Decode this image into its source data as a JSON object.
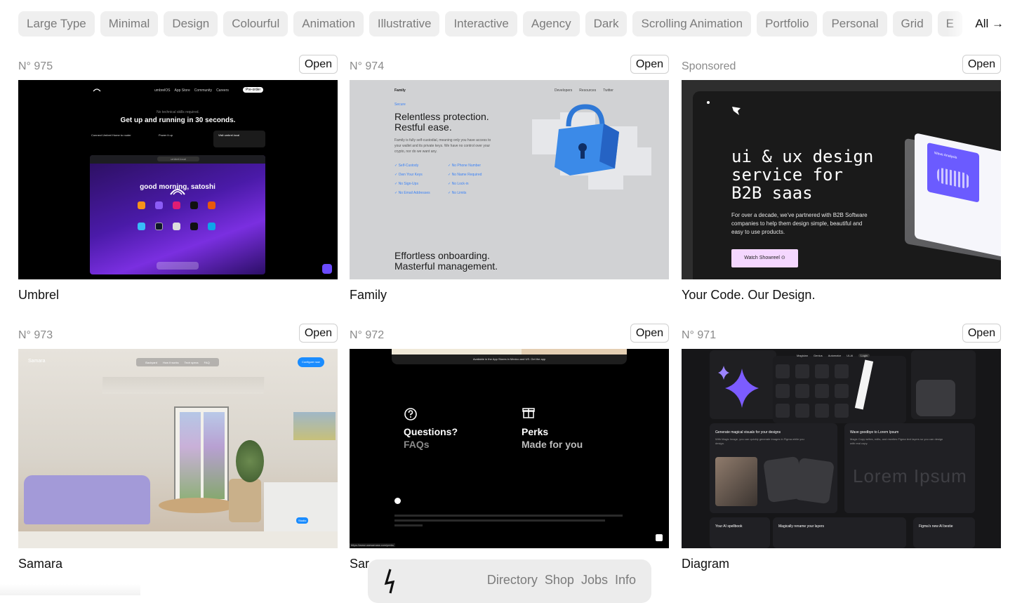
{
  "filters": {
    "chips": [
      "Large Type",
      "Minimal",
      "Design",
      "Colourful",
      "Animation",
      "Illustrative",
      "Interactive",
      "Agency",
      "Dark",
      "Scrolling Animation",
      "Portfolio",
      "Personal",
      "Grid",
      "E"
    ],
    "all_label": "All →"
  },
  "cards": [
    {
      "num": "N° 975",
      "open": "Open",
      "title": "Umbrel",
      "shot": {
        "nav": [
          "umbrelOS",
          "App Store",
          "Community",
          "Careers"
        ],
        "preorder": "Pre-order",
        "tagline": "No technical skills required.",
        "headline": "Get up and running in 30 seconds.",
        "step1": "Connect Umbrel Home to router",
        "step2": "Power it up",
        "step3": "Visit umbrel.local",
        "url": "umbrel.local",
        "greeting": "good morning, satoshi"
      }
    },
    {
      "num": "N° 974",
      "open": "Open",
      "title": "Family",
      "shot": {
        "brand": "Family",
        "nav": [
          "Developers",
          "Resources",
          "Twitter"
        ],
        "eyebrow": "Secure",
        "h1": "Relentless protection.",
        "h2": "Restful ease.",
        "body": "Family is fully self-custodial, meaning only you have access to your wallet and its private keys. We have no control over your crypto, nor do we want any.",
        "checks_left": [
          "Self-Custody",
          "Own Your Keys",
          "No Sign-Ups",
          "No Email Addresses"
        ],
        "checks_right": [
          "No Phone Number",
          "No Name Required",
          "No Lock-in",
          "No Limits"
        ],
        "footer1": "Effortless onboarding.",
        "footer2": "Masterful management."
      }
    },
    {
      "num": "Sponsored",
      "open": "Open",
      "title": "Your Code. Our Design.",
      "shot": {
        "h1": "ui & ux design",
        "h2": "service for",
        "h3": "B2B saas",
        "body": "For over a decade, we've partnered with B2B Software companies to help them design simple, beautiful and easy to use products.",
        "cta": "Watch Showreel",
        "widget": "Wave Analysis"
      }
    },
    {
      "num": "N° 973",
      "open": "Open",
      "title": "Samara",
      "shot": {
        "brand": "Samara",
        "nav": [
          "Backyard",
          "How it works",
          "Tech specs",
          "FAQ"
        ],
        "cta": "Configure now",
        "toggle": "Studio"
      }
    },
    {
      "num": "N° 972",
      "open": "Open",
      "title": "Sar",
      "shot": {
        "banner": "Available in the App Stores in Mexico and US. Get the app",
        "q1": "Questions?",
        "q2": "FAQs",
        "p1": "Perks",
        "p2": "Made for you",
        "url": "https://www.usesamara.com/perks"
      }
    },
    {
      "num": "N° 971",
      "open": "Open",
      "title": "Diagram",
      "shot": {
        "nav": [
          "Magician",
          "Genius",
          "Automator",
          "UI-AI",
          "Login"
        ],
        "c1t": "Generate magical visuals for your designs",
        "c1b": "With Magic Image, you can quickly generate images in Figma while you design.",
        "c2t": "Wave goodbye to Lorem Ipsum",
        "c2b": "Magic Copy writes, edits, and rewrites Figma text layers so you can design with real copy.",
        "lorem": "Lorem Ipsum",
        "f1t": "Your AI spellbook",
        "f2t": "Magically rename your layers",
        "f3t": "Figma's new AI bestie"
      }
    }
  ],
  "bottom_nav": {
    "links": [
      "Directory",
      "Shop",
      "Jobs",
      "Info"
    ]
  },
  "colors": {
    "accent_purple": "#6b4bff",
    "chip_bg": "#efefef",
    "chip_text": "#7b7b7b"
  }
}
